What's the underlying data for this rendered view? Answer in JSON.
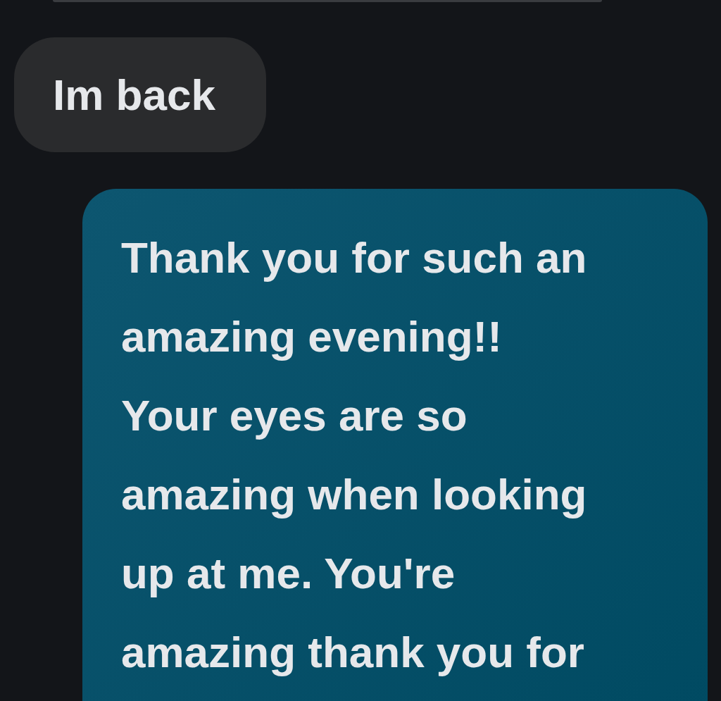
{
  "messages": [
    {
      "kind": "received",
      "text": "Im back"
    },
    {
      "kind": "sent",
      "text": "Thank you for such an\namazing evening!!\nYour eyes are so\namazing when looking\nup at me. You're\namazing thank you for"
    }
  ]
}
